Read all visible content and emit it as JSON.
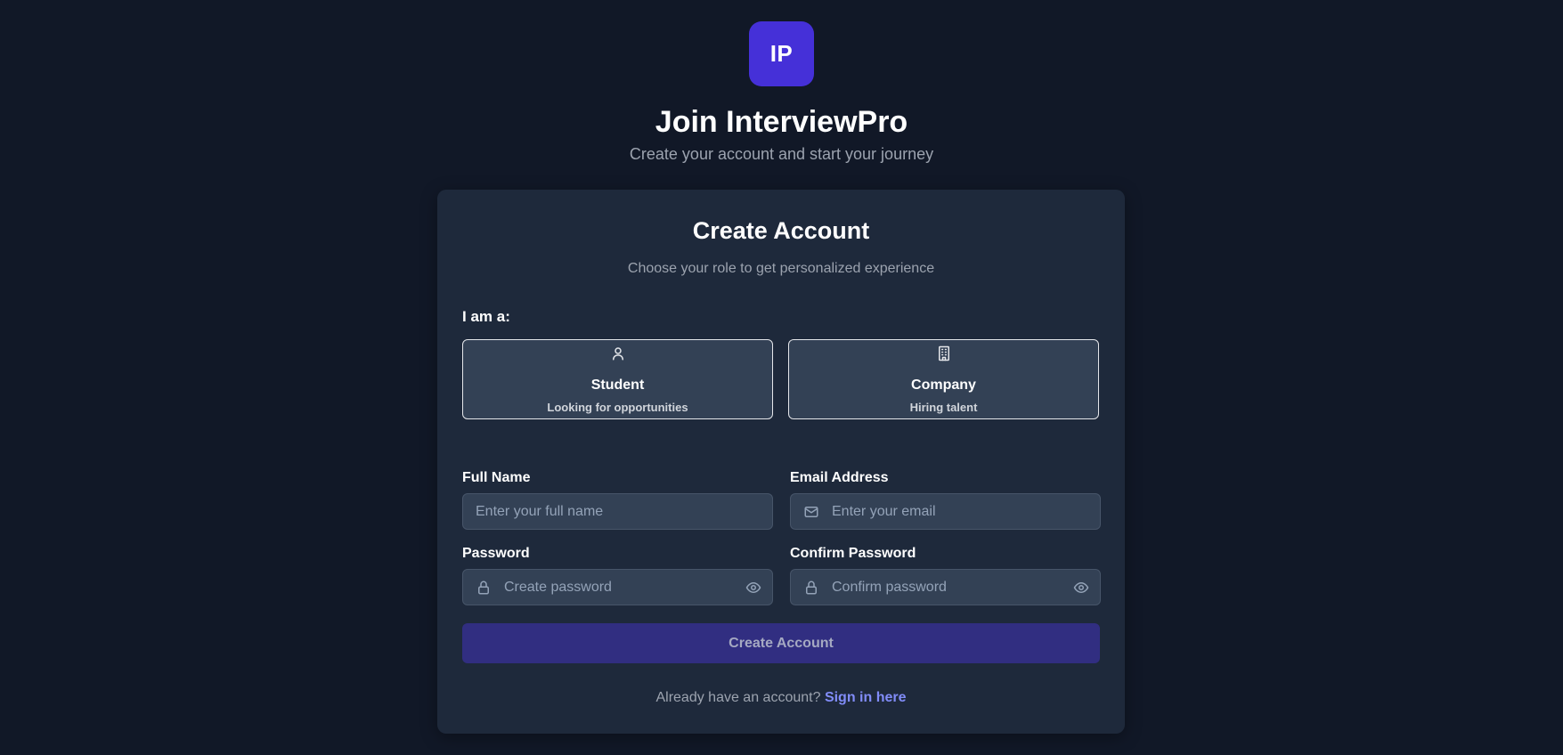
{
  "brand": {
    "logo_text": "IP",
    "logo_color": "#4530d8",
    "title": "Join InterviewPro",
    "subtitle": "Create your account and start your journey"
  },
  "card": {
    "title": "Create Account",
    "subtitle": "Choose your role to get personalized experience",
    "role_prompt": "I am a:",
    "roles": [
      {
        "name": "Student",
        "description": "Looking for opportunities",
        "icon": "user-icon"
      },
      {
        "name": "Company",
        "description": "Hiring talent",
        "icon": "building-icon"
      }
    ],
    "fields": {
      "full_name": {
        "label": "Full Name",
        "placeholder": "Enter your full name",
        "value": ""
      },
      "email": {
        "label": "Email Address",
        "placeholder": "Enter your email",
        "value": "",
        "icon": "mail-icon"
      },
      "password": {
        "label": "Password",
        "placeholder": "Create password",
        "value": "",
        "icon": "lock-icon",
        "toggle_icon": "eye-icon"
      },
      "confirm_password": {
        "label": "Confirm Password",
        "placeholder": "Confirm password",
        "value": "",
        "icon": "lock-icon",
        "toggle_icon": "eye-icon"
      }
    },
    "submit_label": "Create Account",
    "submit_color": "#312e81",
    "signin_prompt": "Already have an account?",
    "signin_link": "Sign in here",
    "link_color": "#818cf8"
  }
}
